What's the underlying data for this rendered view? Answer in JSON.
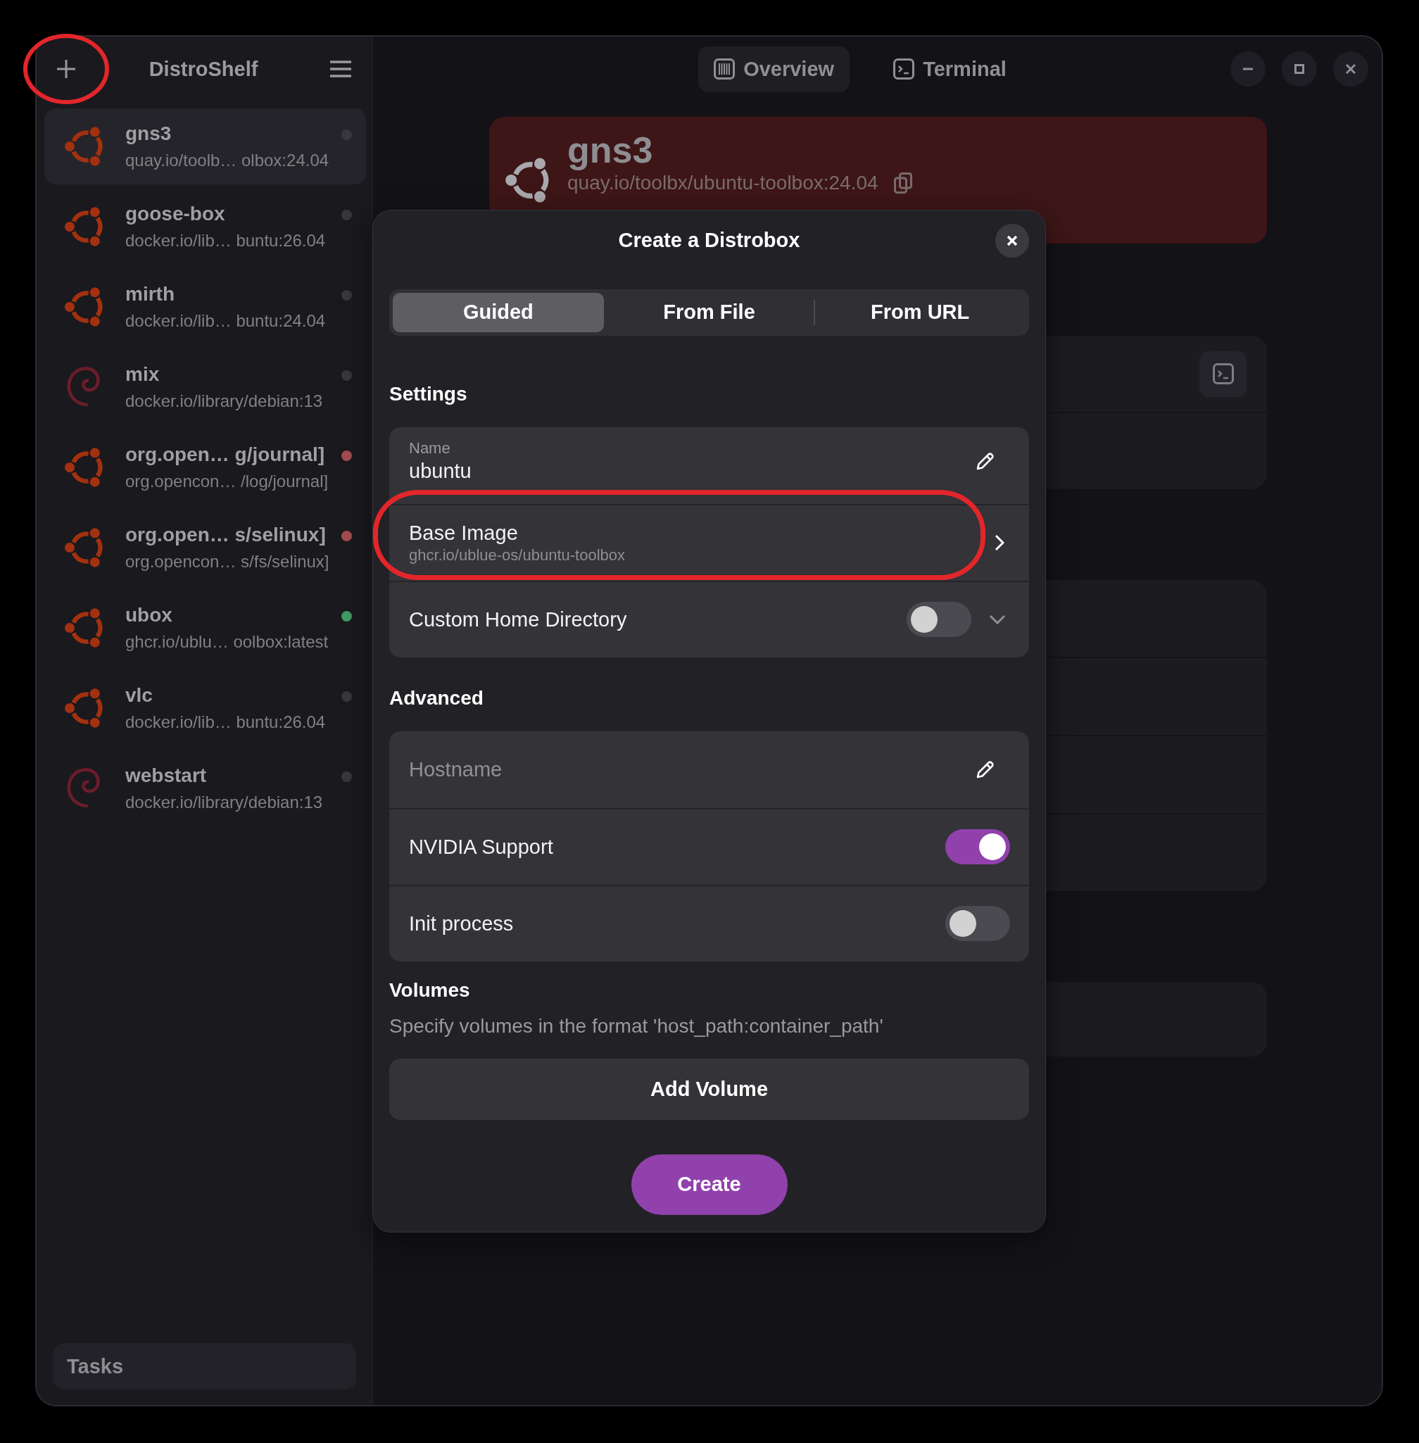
{
  "sidebar": {
    "add_button": {
      "highlighted": true
    },
    "title": "DistroShelf",
    "items": [
      {
        "kind": "ubuntu",
        "name": "gns3",
        "image": "quay.io/toolb… olbox:24.04",
        "color": "#38373d",
        "selected": true
      },
      {
        "kind": "ubuntu",
        "name": "goose-box",
        "image": "docker.io/lib… buntu:26.04",
        "color": "#38373d",
        "selected": false
      },
      {
        "kind": "ubuntu",
        "name": "mirth",
        "image": "docker.io/lib… buntu:24.04",
        "color": "#38373d",
        "selected": false
      },
      {
        "kind": "debian",
        "name": "mix",
        "image": "docker.io/library/debian:13",
        "color": "#38373d",
        "selected": false
      },
      {
        "kind": "ubuntu",
        "name": "org.open… g/journal]",
        "image": "org.opencon… /log/journal]",
        "color": "#a34c51",
        "selected": false
      },
      {
        "kind": "ubuntu",
        "name": "org.open… s/selinux]",
        "image": "org.opencon… s/fs/selinux]",
        "color": "#a34c51",
        "selected": false
      },
      {
        "kind": "ubuntu",
        "name": "ubox",
        "image": "ghcr.io/ublu… oolbox:latest",
        "color": "#3f9b64",
        "selected": false
      },
      {
        "kind": "ubuntu",
        "name": "vlc",
        "image": "docker.io/lib… buntu:26.04",
        "color": "#38373d",
        "selected": false
      },
      {
        "kind": "debian",
        "name": "webstart",
        "image": "docker.io/library/debian:13",
        "color": "#38373d",
        "selected": false
      }
    ],
    "tasks_button": "Tasks"
  },
  "header": {
    "tabs": [
      {
        "kind": "overview",
        "label": "Overview",
        "selected": true
      },
      {
        "kind": "terminal",
        "label": "Terminal",
        "selected": false
      }
    ]
  },
  "banner": {
    "kind": "ubuntu",
    "name": "gns3",
    "image": "quay.io/toolbx/ubuntu-toolbox:24.04"
  },
  "dialog": {
    "title": "Create a Distrobox",
    "modes": [
      {
        "label": "Guided",
        "selected": true
      },
      {
        "label": "From File",
        "selected": false
      },
      {
        "label": "From URL",
        "selected": false
      }
    ],
    "sections": [
      {
        "heading": "Settings",
        "rows": [
          {
            "kind": "entry",
            "label": "Name",
            "value": "ubuntu"
          },
          {
            "kind": "chooser",
            "title": "Base Image",
            "subtitle": "ghcr.io/ublue-os/ubuntu-toolbox",
            "highlighted": true
          },
          {
            "kind": "expander",
            "title": "Custom Home Directory",
            "on": false,
            "expanded": false
          }
        ]
      },
      {
        "heading": "Advanced",
        "rows": [
          {
            "kind": "entry",
            "placeholder": "Hostname"
          },
          {
            "kind": "switch",
            "title": "NVIDIA Support",
            "on": true
          },
          {
            "kind": "switch",
            "title": "Init process",
            "on": false
          }
        ]
      }
    ],
    "volumes": {
      "heading": "Volumes",
      "description": "Specify volumes in the format 'host_path:container_path'",
      "add_button": "Add Volume"
    },
    "create_button": "Create"
  }
}
